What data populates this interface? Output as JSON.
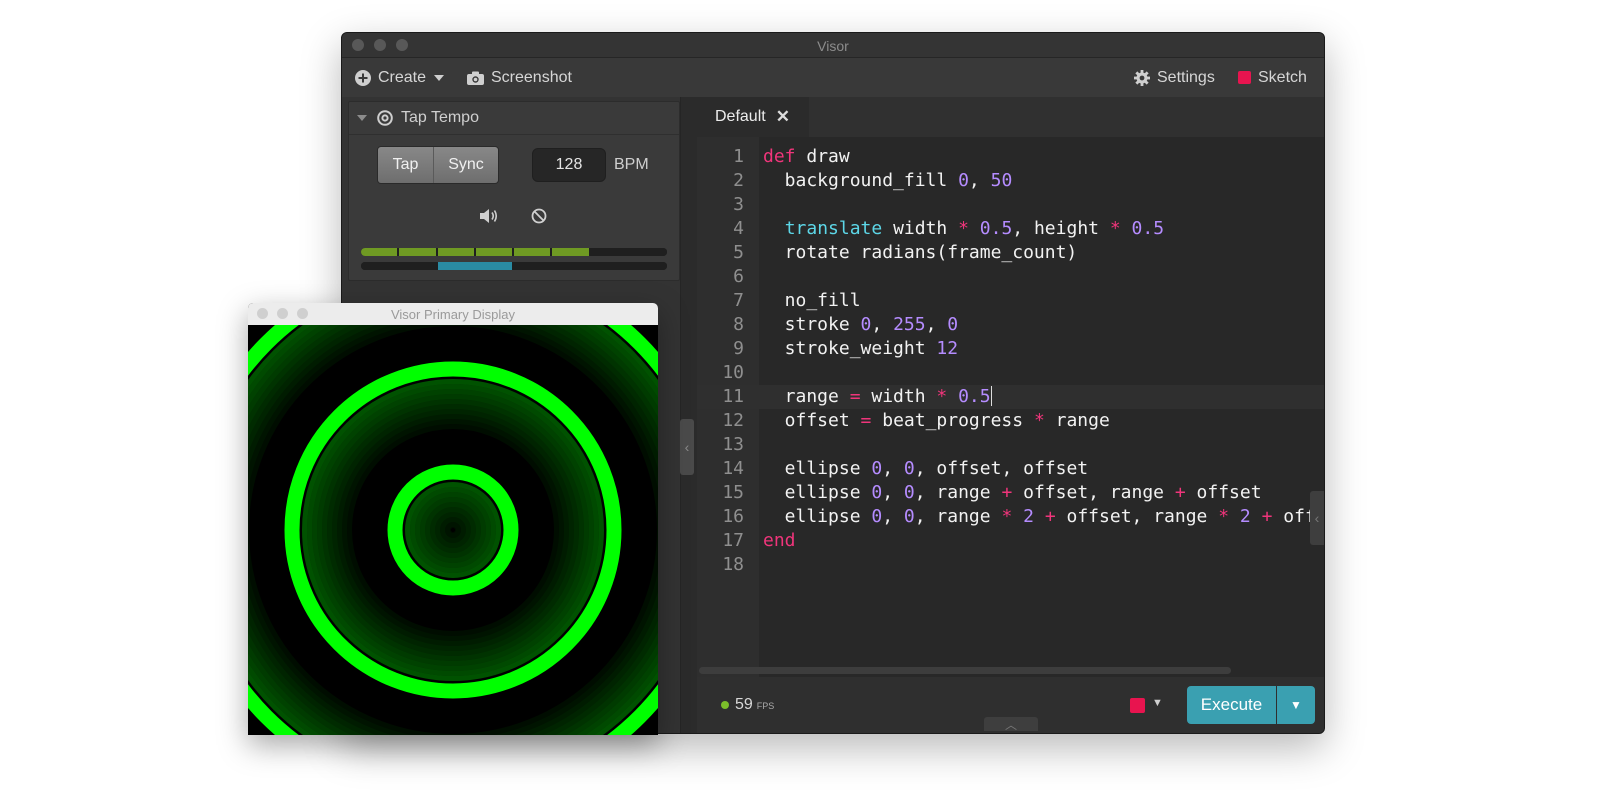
{
  "main_window": {
    "title": "Visor"
  },
  "toolbar": {
    "create_label": "Create",
    "screenshot_label": "Screenshot",
    "settings_label": "Settings",
    "sketch_label": "Sketch",
    "sketch_color": "#e8144f"
  },
  "tap_tempo": {
    "title": "Tap Tempo",
    "tap_label": "Tap",
    "sync_label": "Sync",
    "bpm_value": "128",
    "bpm_unit": "BPM",
    "beat_meter_lit_segments": 6,
    "beat_meter_total_segments": 8,
    "bar_meter_active_segment": 2,
    "bar_meter_total_segments": 4
  },
  "editor": {
    "tab_label": "Default",
    "active_line": 11,
    "lines": [
      {
        "n": "1",
        "t": [
          [
            "kw",
            "def"
          ],
          [
            "",
            "draw"
          ]
        ]
      },
      {
        "n": "2",
        "t": [
          [
            "",
            "  background_fill "
          ],
          [
            "num",
            "0"
          ],
          [
            "",
            ", "
          ],
          [
            "num",
            "50"
          ]
        ]
      },
      {
        "n": "3",
        "t": []
      },
      {
        "n": "4",
        "t": [
          [
            "",
            "  "
          ],
          [
            "fn",
            "translate"
          ],
          [
            "",
            " width "
          ],
          [
            "op",
            "*"
          ],
          [
            "",
            " "
          ],
          [
            "num",
            "0.5"
          ],
          [
            "",
            ", height "
          ],
          [
            "op",
            "*"
          ],
          [
            "",
            " "
          ],
          [
            "num",
            "0.5"
          ]
        ]
      },
      {
        "n": "5",
        "t": [
          [
            "",
            "  rotate radians(frame_count)"
          ]
        ]
      },
      {
        "n": "6",
        "t": []
      },
      {
        "n": "7",
        "t": [
          [
            "",
            "  no_fill"
          ]
        ]
      },
      {
        "n": "8",
        "t": [
          [
            "",
            "  stroke "
          ],
          [
            "num",
            "0"
          ],
          [
            "",
            ", "
          ],
          [
            "num",
            "255"
          ],
          [
            "",
            ", "
          ],
          [
            "num",
            "0"
          ]
        ]
      },
      {
        "n": "9",
        "t": [
          [
            "",
            "  stroke_weight "
          ],
          [
            "num",
            "12"
          ]
        ]
      },
      {
        "n": "10",
        "t": []
      },
      {
        "n": "11",
        "t": [
          [
            "",
            "  range "
          ],
          [
            "op",
            "="
          ],
          [
            "",
            " width "
          ],
          [
            "op",
            "*"
          ],
          [
            "",
            " "
          ],
          [
            "num",
            "0.5"
          ]
        ]
      },
      {
        "n": "12",
        "t": [
          [
            "",
            "  offset "
          ],
          [
            "op",
            "="
          ],
          [
            "",
            " beat_progress "
          ],
          [
            "op",
            "*"
          ],
          [
            "",
            " range"
          ]
        ]
      },
      {
        "n": "13",
        "t": []
      },
      {
        "n": "14",
        "t": [
          [
            "",
            "  ellipse "
          ],
          [
            "num",
            "0"
          ],
          [
            "",
            ", "
          ],
          [
            "num",
            "0"
          ],
          [
            "",
            ", offset, offset"
          ]
        ]
      },
      {
        "n": "15",
        "t": [
          [
            "",
            "  ellipse "
          ],
          [
            "num",
            "0"
          ],
          [
            "",
            ", "
          ],
          [
            "num",
            "0"
          ],
          [
            "",
            ", range "
          ],
          [
            "op",
            "+"
          ],
          [
            "",
            " offset, range "
          ],
          [
            "op",
            "+"
          ],
          [
            "",
            " offset"
          ]
        ]
      },
      {
        "n": "16",
        "t": [
          [
            "",
            "  ellipse "
          ],
          [
            "num",
            "0"
          ],
          [
            "",
            ", "
          ],
          [
            "num",
            "0"
          ],
          [
            "",
            ", range "
          ],
          [
            "op",
            "*"
          ],
          [
            "",
            " "
          ],
          [
            "num",
            "2"
          ],
          [
            "",
            " "
          ],
          [
            "op",
            "+"
          ],
          [
            "",
            " offset, range "
          ],
          [
            "op",
            "*"
          ],
          [
            "",
            " "
          ],
          [
            "num",
            "2"
          ],
          [
            "",
            " "
          ],
          [
            "op",
            "+"
          ],
          [
            "",
            " offset"
          ]
        ]
      },
      {
        "n": "17",
        "t": [
          [
            "kw",
            "end"
          ]
        ]
      },
      {
        "n": "18",
        "t": []
      }
    ]
  },
  "status": {
    "fps_value": "59",
    "fps_unit": "FPS",
    "color_swatch": "#e8144f",
    "execute_label": "Execute"
  },
  "display_window": {
    "title": "Visor Primary Display",
    "ring_color": "#00ff00"
  }
}
